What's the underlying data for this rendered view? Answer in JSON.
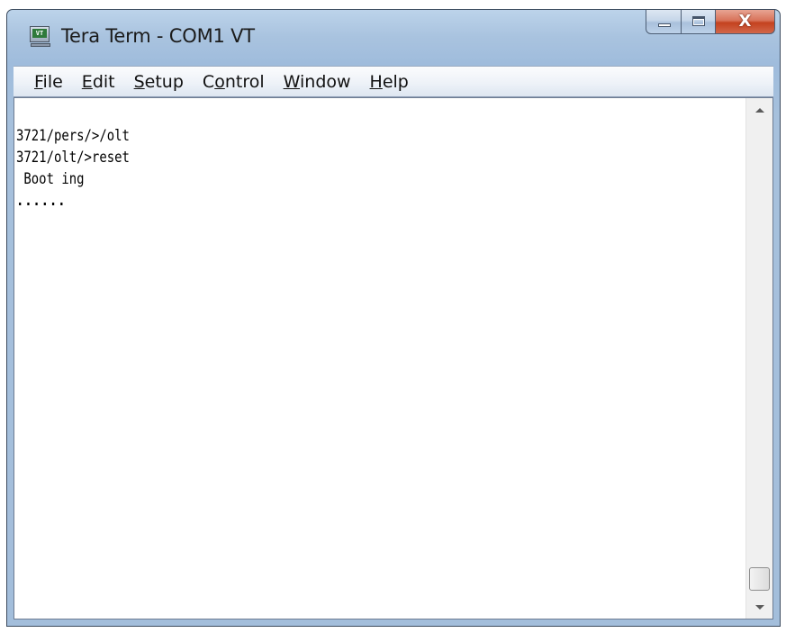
{
  "window": {
    "title": "Tera Term - COM1 VT",
    "icon_label": "VT",
    "icon": "teraterm-terminal-icon",
    "close_glyph": "X"
  },
  "menu": {
    "items": [
      {
        "label_ul": "F",
        "label_rest": "ile"
      },
      {
        "label_ul": "E",
        "label_rest": "dit"
      },
      {
        "label_ul": "S",
        "label_rest": "etup"
      },
      {
        "label_pre": "C",
        "label_ul": "o",
        "label_rest": "ntrol"
      },
      {
        "label_ul": "W",
        "label_rest": "indow"
      },
      {
        "label_ul": "H",
        "label_rest": "elp"
      }
    ]
  },
  "terminal": {
    "lines": [
      "3721/pers/>/olt",
      "3721/olt/>reset",
      " Boot ing",
      "......"
    ]
  },
  "colors": {
    "titlebar": "#a9c3df",
    "close_button": "#c4421f",
    "terminal_bg": "#ffffff",
    "terminal_fg": "#000000"
  }
}
